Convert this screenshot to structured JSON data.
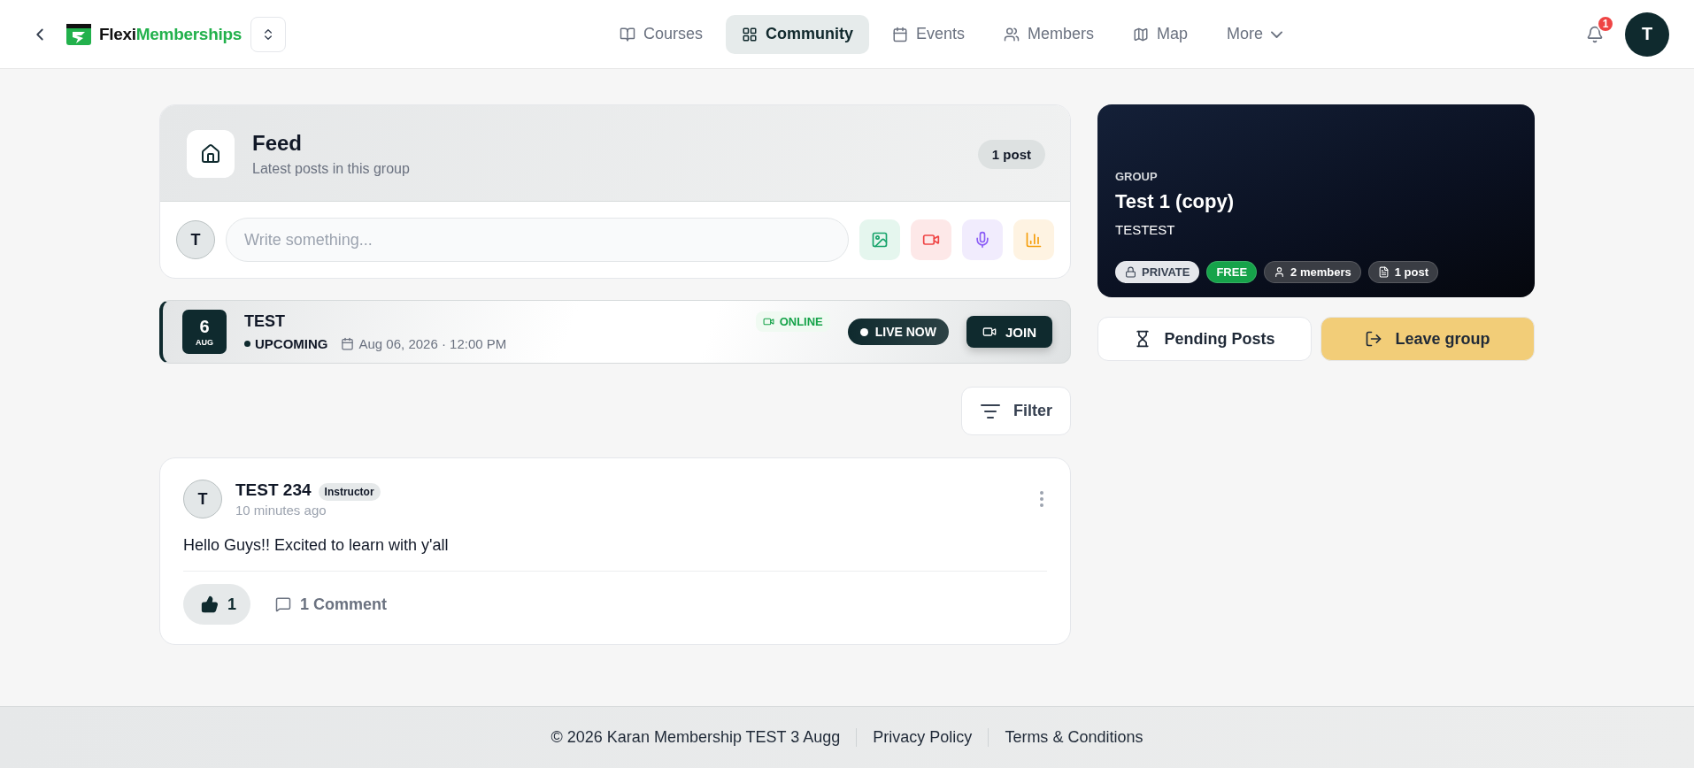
{
  "header": {
    "brand": {
      "first": "Flexi",
      "second": "Memberships"
    },
    "nav": [
      {
        "label": "Courses",
        "kind": "link",
        "selected": false
      },
      {
        "label": "Community",
        "kind": "link",
        "selected": true
      },
      {
        "label": "Events",
        "kind": "link",
        "selected": false
      },
      {
        "label": "Members",
        "kind": "link",
        "selected": false
      },
      {
        "label": "Map",
        "kind": "link",
        "selected": false
      },
      {
        "label": "More",
        "kind": "dropdown",
        "selected": false
      }
    ],
    "notification_count": "1",
    "avatar": "T"
  },
  "feed": {
    "title": "Feed",
    "subtitle": "Latest posts in this group",
    "count": "1 post",
    "composer": {
      "avatar": "T",
      "placeholder": "Write something..."
    }
  },
  "event": {
    "day": "6",
    "month": "AUG",
    "title": "TEST",
    "status": "UPCOMING",
    "datetime": "Aug 06, 2026 · 12:00 PM",
    "mode": "ONLINE",
    "live": "LIVE NOW",
    "join": "JOIN"
  },
  "filter": "Filter",
  "posts": [
    {
      "avatar": "T",
      "author": "TEST 234",
      "role": "Instructor",
      "time": "10 minutes ago",
      "body": "Hello Guys!! Excited to learn with y'all",
      "likes": "1",
      "comments": "1 Comment"
    }
  ],
  "group": {
    "label": "GROUP",
    "name": "Test 1 (copy)",
    "description": "TESTEST",
    "badges": [
      {
        "kind": "private",
        "label": "PRIVATE"
      },
      {
        "kind": "free",
        "label": "FREE"
      },
      {
        "kind": "members",
        "label": "2 members"
      },
      {
        "kind": "posts",
        "label": "1 post"
      }
    ],
    "actions": [
      {
        "kind": "pending",
        "label": "Pending Posts"
      },
      {
        "kind": "leave",
        "label": "Leave group"
      }
    ]
  },
  "footer": {
    "copyright": "© 2026 Karan Membership TEST 3 Augg",
    "links": [
      "Privacy Policy",
      "Terms & Conditions"
    ]
  }
}
